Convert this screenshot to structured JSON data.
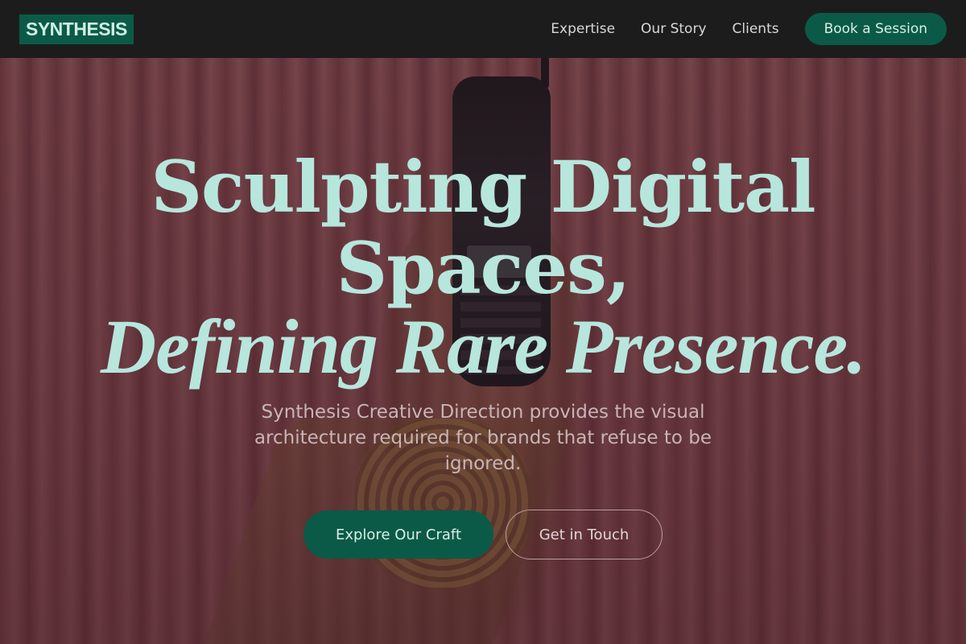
{
  "brand": {
    "logo_text": "SYNTHESIS"
  },
  "nav": {
    "links": [
      "Expertise",
      "Our Story",
      "Clients"
    ],
    "cta_label": "Book a Session"
  },
  "hero": {
    "headline_line1": "Sculpting Digital",
    "headline_line2": "Spaces,",
    "headline_line3": "Defining Rare Presence.",
    "subtitle": "Synthesis Creative Direction provides the visual architecture required for brands that refuse to be ignored.",
    "primary_cta": "Explore Our Craft",
    "secondary_cta": "Get in Touch"
  },
  "colors": {
    "accent": "#0b5a47",
    "headline": "#b7e6dc",
    "nav_bg": "#1c1c1c"
  }
}
